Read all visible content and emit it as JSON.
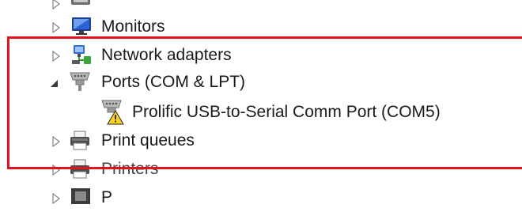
{
  "tree": {
    "items": [
      {
        "label": "",
        "icon": "cut-off-device-icon",
        "expanded": false
      },
      {
        "label": "Monitors",
        "icon": "monitor-icon",
        "expanded": false
      },
      {
        "label": "Network adapters",
        "icon": "network-adapter-icon",
        "expanded": false
      },
      {
        "label": "Ports (COM & LPT)",
        "icon": "port-icon",
        "expanded": true
      },
      {
        "label": "Prolific USB-to-Serial Comm Port (COM5)",
        "icon": "port-warning-icon",
        "child": true
      },
      {
        "label": "Print queues",
        "icon": "printer-icon",
        "expanded": false
      },
      {
        "label": "Printers",
        "icon": "printer-icon",
        "expanded": false
      },
      {
        "label": "P",
        "icon": "processor-icon",
        "expanded": false
      }
    ]
  },
  "annotation": {
    "color": "#e3131e"
  }
}
